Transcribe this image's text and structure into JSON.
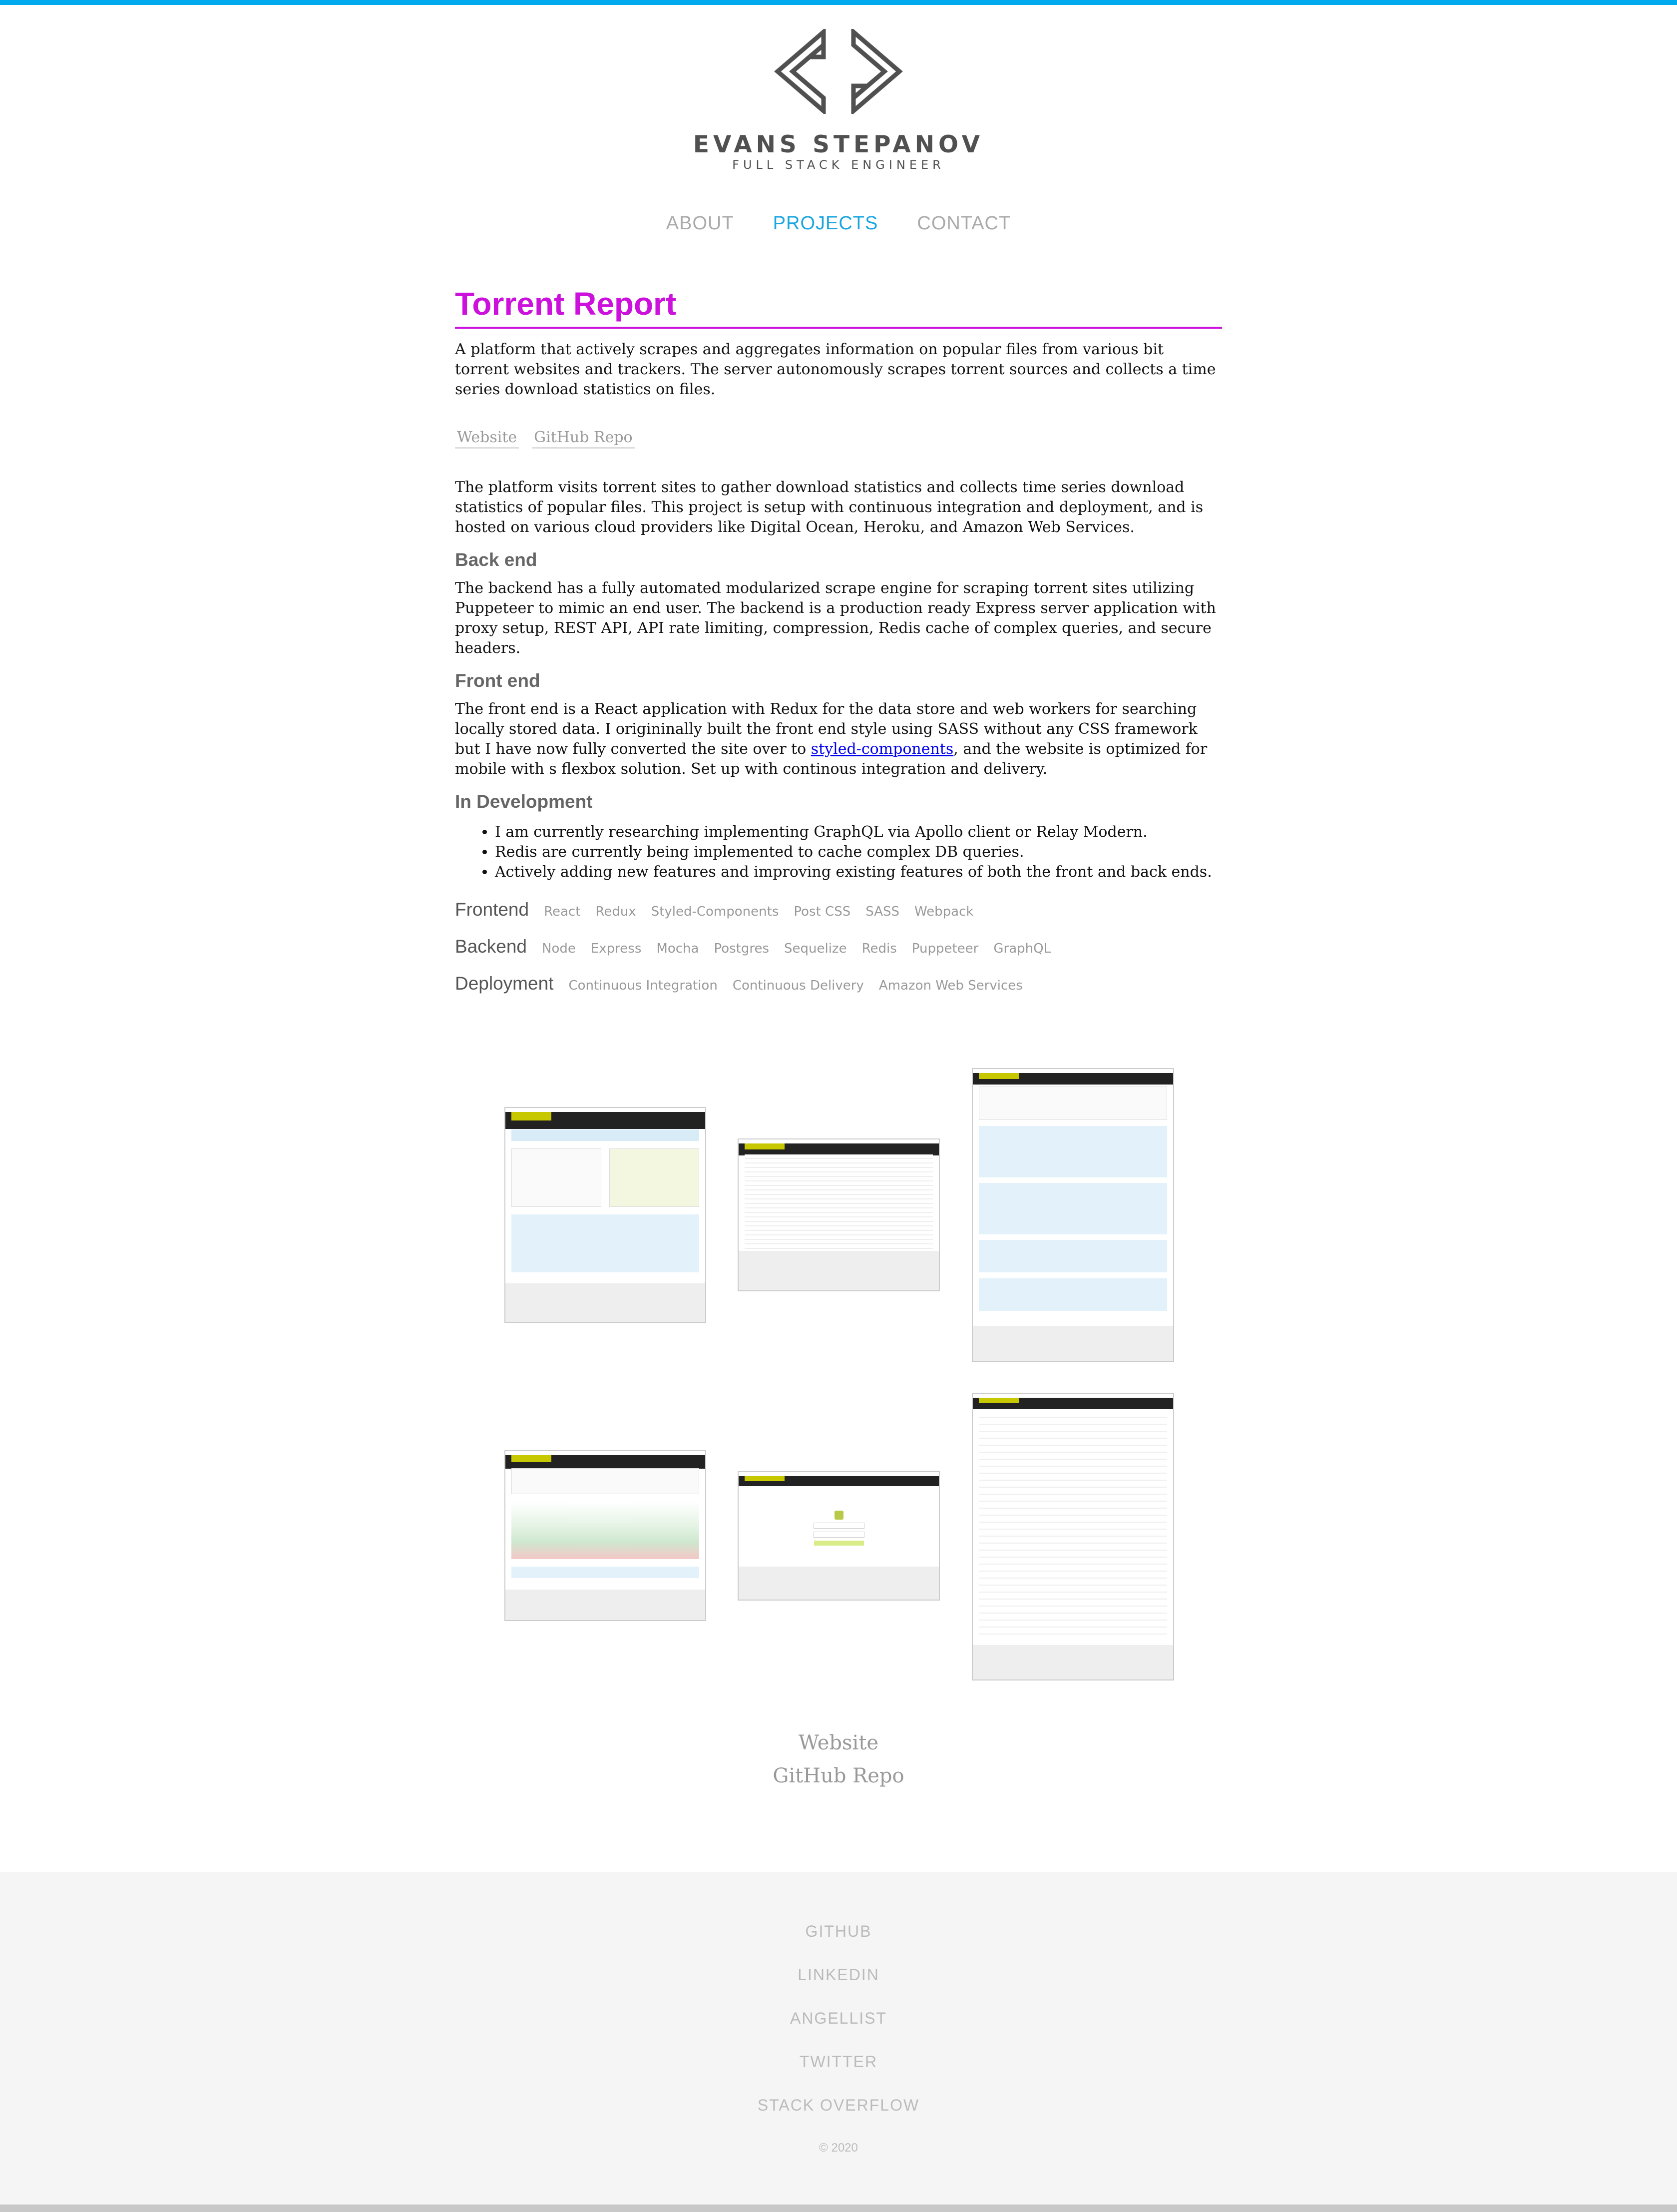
{
  "header": {
    "brand_name": "EVANS STEPANOV",
    "brand_subtitle": "FULL STACK ENGINEER",
    "logo_icon": "code-brackets-icon",
    "accent_color": "#00aaee"
  },
  "nav": {
    "items": [
      {
        "label": "ABOUT",
        "active": false
      },
      {
        "label": "PROJECTS",
        "active": true
      },
      {
        "label": "CONTACT",
        "active": false
      }
    ]
  },
  "project": {
    "title": "Torrent Report",
    "title_color": "#cc11dd",
    "summary": "A platform that actively scrapes and aggregates information on popular files from various bit torrent websites and trackers. The server autonomously scrapes torrent sources and collects a time series download statistics on files.",
    "top_links": {
      "website": "Website",
      "github": "GitHub Repo"
    },
    "intro": "The platform visits torrent sites to gather download statistics and collects time series download statistics of popular files. This project is setup with continuous integration and deployment, and is hosted on various cloud providers like Digital Ocean, Heroku, and Amazon Web Services.",
    "backend_heading": "Back end",
    "backend_text": "The backend has a fully automated modularized scrape engine for scraping torrent sites utilizing Puppeteer to mimic an end user. The backend is a production ready Express server application with proxy setup, REST API, API rate limiting, compression, Redis cache of complex queries, and secure headers.",
    "frontend_heading": "Front end",
    "frontend_text_before": "The front end is a React application with Redux for the data store and web workers for searching locally stored data. I origininally built the front end style using SASS without any CSS framework but I have now fully converted the site over to ",
    "frontend_link": "styled-components",
    "frontend_text_after": ", and the website is optimized for mobile with s flexbox solution. Set up with continous integration and delivery.",
    "dev_heading": "In Development",
    "dev_items": [
      "I am currently researching implementing GraphQL via Apollo client or Relay Modern.",
      "Redis are currently being implemented to cache complex DB queries.",
      "Actively adding new features and improving existing features of both the front and back ends."
    ],
    "stack": {
      "frontend": {
        "label": "Frontend",
        "tags": [
          "React",
          "Redux",
          "Styled-Components",
          "Post CSS",
          "SASS",
          "Webpack"
        ]
      },
      "backend": {
        "label": "Backend",
        "tags": [
          "Node",
          "Express",
          "Mocha",
          "Postgres",
          "Sequelize",
          "Redis",
          "Puppeteer",
          "GraphQL"
        ]
      },
      "deployment": {
        "label": "Deployment",
        "tags": [
          "Continuous Integration",
          "Continuous Delivery",
          "Amazon Web Services"
        ]
      }
    },
    "bottom_links": {
      "website": "Website",
      "github": "GitHub Repo"
    }
  },
  "footer": {
    "links": [
      "GITHUB",
      "LINKEDIN",
      "ANGELLIST",
      "TWITTER",
      "STACK OVERFLOW"
    ],
    "copyright": "© 2020"
  }
}
